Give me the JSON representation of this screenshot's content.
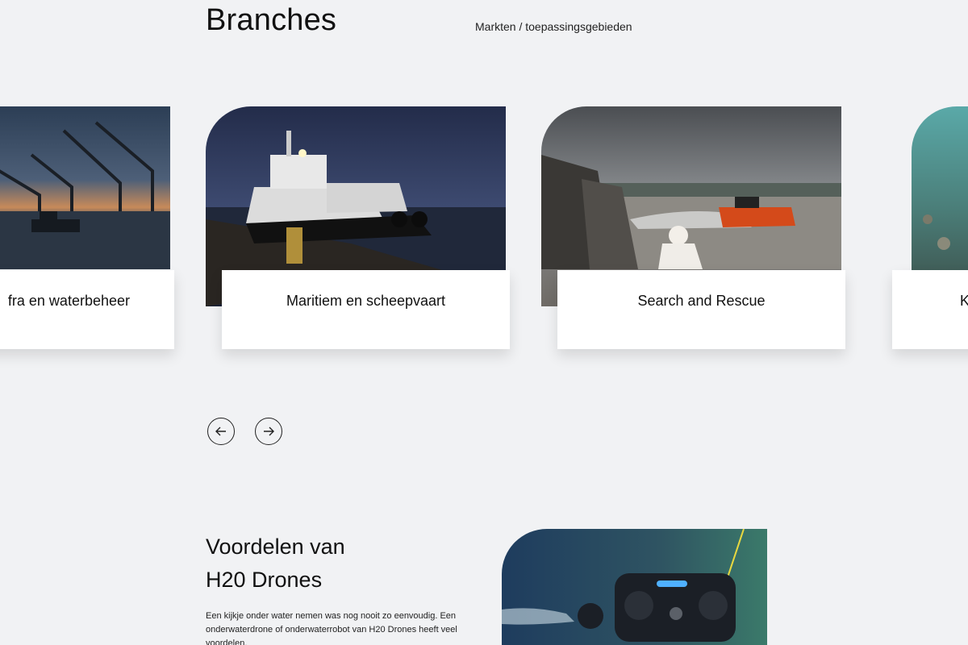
{
  "header": {
    "title": "Branches",
    "subtitle": "Markten / toepassingsgebieden"
  },
  "carousel": {
    "cards": [
      {
        "label": "fra en waterbeheer",
        "image": "harbor-cranes-sunset"
      },
      {
        "label": "Maritiem en scheepvaart",
        "image": "tugboats-at-night"
      },
      {
        "label": "Search and Rescue",
        "image": "rescue-boat-at-sea"
      },
      {
        "label": "K",
        "image": "underwater-seabed"
      }
    ],
    "prev_icon": "arrow-left-icon",
    "next_icon": "arrow-right-icon"
  },
  "benefits": {
    "title_line1": "Voordelen van",
    "title_line2": "H20 Drones",
    "text": "Een kijkje onder water nemen was nog nooit zo eenvoudig. Een onderwaterdrone of onderwaterrobot van H20 Drones heeft veel voordelen."
  },
  "colors": {
    "page_bg": "#f1f2f4",
    "card_bg": "#ffffff",
    "text": "#111111"
  }
}
